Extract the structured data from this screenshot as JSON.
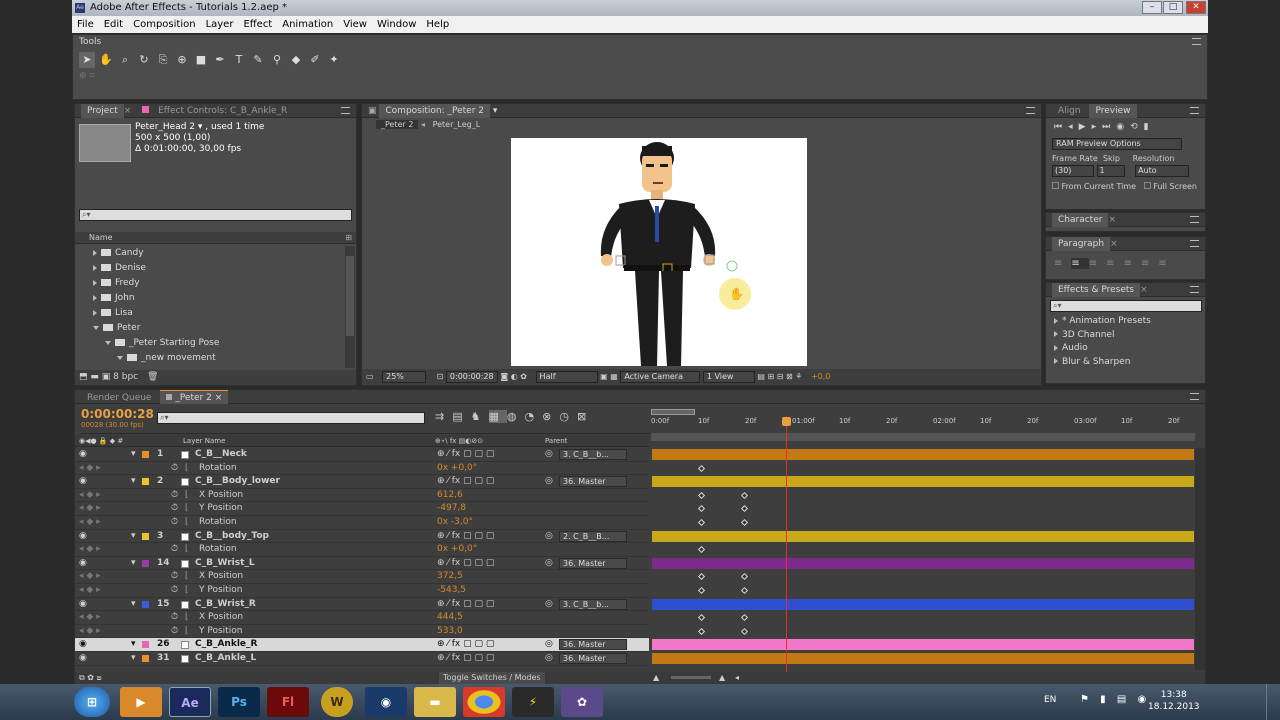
{
  "window": {
    "title": "Adobe After Effects - Tutorials 1.2.aep *",
    "app_icon": "Ae"
  },
  "menu": [
    "File",
    "Edit",
    "Composition",
    "Layer",
    "Effect",
    "Animation",
    "View",
    "Window",
    "Help"
  ],
  "tools_panel": {
    "title": "Tools"
  },
  "project_panel": {
    "tabs": [
      "Project",
      "Effect Controls: C_B_Ankle_R"
    ],
    "item_name": "Peter_Head 2 ▾ , used 1 time",
    "item_size": "500 x 500 (1,00)",
    "item_duration": "Δ 0:01:00:00, 30,00 fps",
    "column_name": "Name",
    "bpc": "8 bpc",
    "items": [
      {
        "label": "Candy",
        "open": false,
        "indent": 1
      },
      {
        "label": "Denise",
        "open": false,
        "indent": 1
      },
      {
        "label": "Fredy",
        "open": false,
        "indent": 1
      },
      {
        "label": "John",
        "open": false,
        "indent": 1
      },
      {
        "label": "Lisa",
        "open": false,
        "indent": 1
      },
      {
        "label": "Peter",
        "open": true,
        "indent": 1
      },
      {
        "label": "_Peter Starting Pose",
        "open": true,
        "indent": 2
      },
      {
        "label": "_new movement",
        "open": true,
        "indent": 3
      }
    ]
  },
  "comp_panel": {
    "tab": "Composition: _Peter 2",
    "breadcrumbs": [
      "_Peter 2",
      "Peter_Leg_L"
    ],
    "zoom": "25%",
    "timecode": "0:00:00:28",
    "resolution": "Half",
    "camera": "Active Camera",
    "view": "1 View",
    "exposure": "+0,0"
  },
  "preview_panel": {
    "tabs": [
      "Align",
      "Preview"
    ],
    "ram_options": "RAM Preview Options",
    "frame_rate_label": "Frame Rate",
    "skip_label": "Skip",
    "resolution_label": "Resolution",
    "frame_rate": "(30)",
    "skip": "1",
    "resolution": "Auto",
    "from_current": "From Current Time",
    "full_screen": "Full Screen"
  },
  "character_panel": {
    "title": "Character"
  },
  "paragraph_panel": {
    "title": "Paragraph"
  },
  "effects_panel": {
    "title": "Effects & Presets",
    "items": [
      "* Animation Presets",
      "3D Channel",
      "Audio",
      "Blur & Sharpen"
    ]
  },
  "timeline": {
    "tabs": [
      "Render Queue",
      "_Peter 2"
    ],
    "timecode": "0:00:00:28",
    "frame_info": "00028 (30.00 fps)",
    "col_layer_name": "Layer Name",
    "col_parent": "Parent",
    "ruler": [
      "0:00f",
      "10f",
      "20f",
      "01:00f",
      "10f",
      "20f",
      "02:00f",
      "10f",
      "20f",
      "03:00f",
      "10f",
      "20f"
    ],
    "toggle_label": "Toggle Switches / Modes",
    "rows": [
      {
        "type": "layer",
        "num": "1",
        "name": "C_B__Neck",
        "color": "#e8902a",
        "parent": "3. C_B__b...",
        "bar": "#c47a14"
      },
      {
        "type": "prop",
        "name": "Rotation",
        "value": "0x +0,0°",
        "keys": [
          1
        ]
      },
      {
        "type": "layer",
        "num": "2",
        "name": "C_B__Body_lower",
        "color": "#e8c52a",
        "parent": "36. Master",
        "bar": "#c9a81a"
      },
      {
        "type": "prop",
        "name": "X Position",
        "value": "612,6",
        "keys": [
          1,
          2
        ]
      },
      {
        "type": "prop",
        "name": "Y Position",
        "value": "-497,8",
        "keys": [
          1,
          2
        ]
      },
      {
        "type": "prop",
        "name": "Rotation",
        "value": "0x -3,0°",
        "keys": [
          1,
          2
        ]
      },
      {
        "type": "layer",
        "num": "3",
        "name": "C_B__body_Top",
        "color": "#e8c52a",
        "parent": "2. C_B__B...",
        "bar": "#c9a81a"
      },
      {
        "type": "prop",
        "name": "Rotation",
        "value": "0x +0,0°",
        "keys": [
          1
        ]
      },
      {
        "type": "layer",
        "num": "14",
        "name": "C_B_Wrist_L",
        "color": "#9a3aa8",
        "parent": "36. Master",
        "bar": "#7c2a8c"
      },
      {
        "type": "prop",
        "name": "X Position",
        "value": "372,5",
        "keys": [
          1,
          2
        ]
      },
      {
        "type": "prop",
        "name": "Y Position",
        "value": "-543,5",
        "keys": [
          1,
          2
        ]
      },
      {
        "type": "layer",
        "num": "15",
        "name": "C_B_Wrist_R",
        "color": "#3a5ad8",
        "parent": "3. C_B__b...",
        "bar": "#2e4fd0"
      },
      {
        "type": "prop",
        "name": "X Position",
        "value": "444,5",
        "keys": [
          1,
          2
        ]
      },
      {
        "type": "prop",
        "name": "Y Position",
        "value": "533,0",
        "keys": [
          1,
          2
        ]
      },
      {
        "type": "layer",
        "num": "26",
        "name": "C_B_Ankle_R",
        "color": "#e866b8",
        "parent": "36. Master",
        "bar": "#f07ac8",
        "selected": true
      },
      {
        "type": "layer",
        "num": "31",
        "name": "C_B_Ankle_L",
        "color": "#e8902a",
        "parent": "36. Master",
        "bar": "#c47a14"
      }
    ]
  },
  "taskbar": {
    "apps": [
      "start",
      "media",
      "Ae",
      "Ps",
      "Fl",
      "W",
      "cinema",
      "folder",
      "chrome",
      "bolt",
      "paint"
    ],
    "lang": "EN",
    "time": "13:38",
    "date": "18.12.2013"
  }
}
